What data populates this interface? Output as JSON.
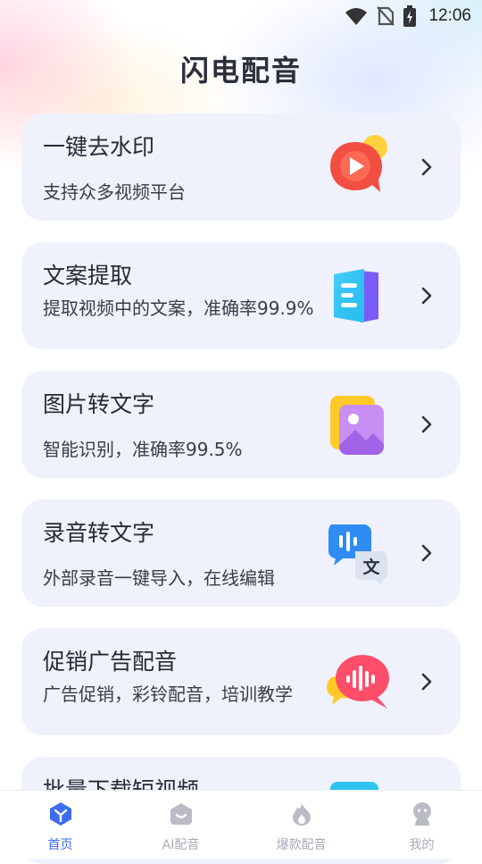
{
  "status_bar": {
    "time": "12:06",
    "icons": [
      "wifi-icon",
      "no-sim-icon",
      "battery-charging-icon"
    ]
  },
  "header": {
    "title": "闪电配音"
  },
  "features": [
    {
      "title": "一键去水印",
      "subtitle": "支持众多视频平台",
      "icon": "video-play-bubble-icon"
    },
    {
      "title": "文案提取",
      "subtitle": "提取视频中的文案，准确率99.9%",
      "icon": "document-extract-icon"
    },
    {
      "title": "图片转文字",
      "subtitle": "智能识别，准确率99.5%",
      "icon": "image-gallery-icon"
    },
    {
      "title": "录音转文字",
      "subtitle": "外部录音一键导入，在线编辑",
      "icon": "voice-to-text-icon"
    },
    {
      "title": "促销广告配音",
      "subtitle": "广告促销，彩铃配音，培训教学",
      "icon": "sound-wave-bubble-icon"
    },
    {
      "title": "批量下载短视频",
      "icon": "download-video-icon"
    }
  ],
  "tabbar": {
    "active": "首页",
    "items": [
      {
        "label": "首页",
        "icon": "home-cube-icon"
      },
      {
        "label": "AI配音",
        "icon": "ai-voice-icon"
      },
      {
        "label": "爆款配音",
        "icon": "flame-icon"
      },
      {
        "label": "我的",
        "icon": "profile-icon"
      }
    ]
  },
  "colors": {
    "accent": "#3d6cf0",
    "card_bg": "#eff2fd",
    "title": "#2b2f3a"
  }
}
